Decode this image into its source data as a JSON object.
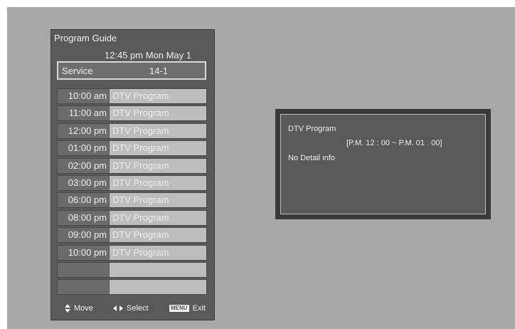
{
  "guide": {
    "title": "Program Guide",
    "datetime": "12:45 pm Mon May 1",
    "service_label": "Service",
    "service_value": "14-1",
    "rows": [
      {
        "time": "10:00 am",
        "program": "DTV Program"
      },
      {
        "time": "11:00 am",
        "program": "DTV Program"
      },
      {
        "time": "12:00 pm",
        "program": "DTV Program"
      },
      {
        "time": "01:00 pm",
        "program": "DTV Program"
      },
      {
        "time": "02:00 pm",
        "program": "DTV Program"
      },
      {
        "time": "03:00 pm",
        "program": "DTV Program"
      },
      {
        "time": "06:00 pm",
        "program": "DTV Program"
      },
      {
        "time": "08:00 pm",
        "program": "DTV Program"
      },
      {
        "time": "09:00 pm",
        "program": "DTV Program"
      },
      {
        "time": "10:00 pm",
        "program": "DTV Program"
      },
      {
        "time": "",
        "program": ""
      },
      {
        "time": "",
        "program": ""
      }
    ]
  },
  "footer": {
    "move_label": "Move",
    "select_label": "Select",
    "menu_key": "MENU",
    "exit_label": "Exit",
    "icons": [
      "up-down-arrows-icon",
      "left-right-arrows-icon"
    ]
  },
  "detail": {
    "title": "DTV Program",
    "time_range": "[P.M. 12 : 00 ~ P.M. 01 : 00]",
    "info": "No Detail info"
  }
}
